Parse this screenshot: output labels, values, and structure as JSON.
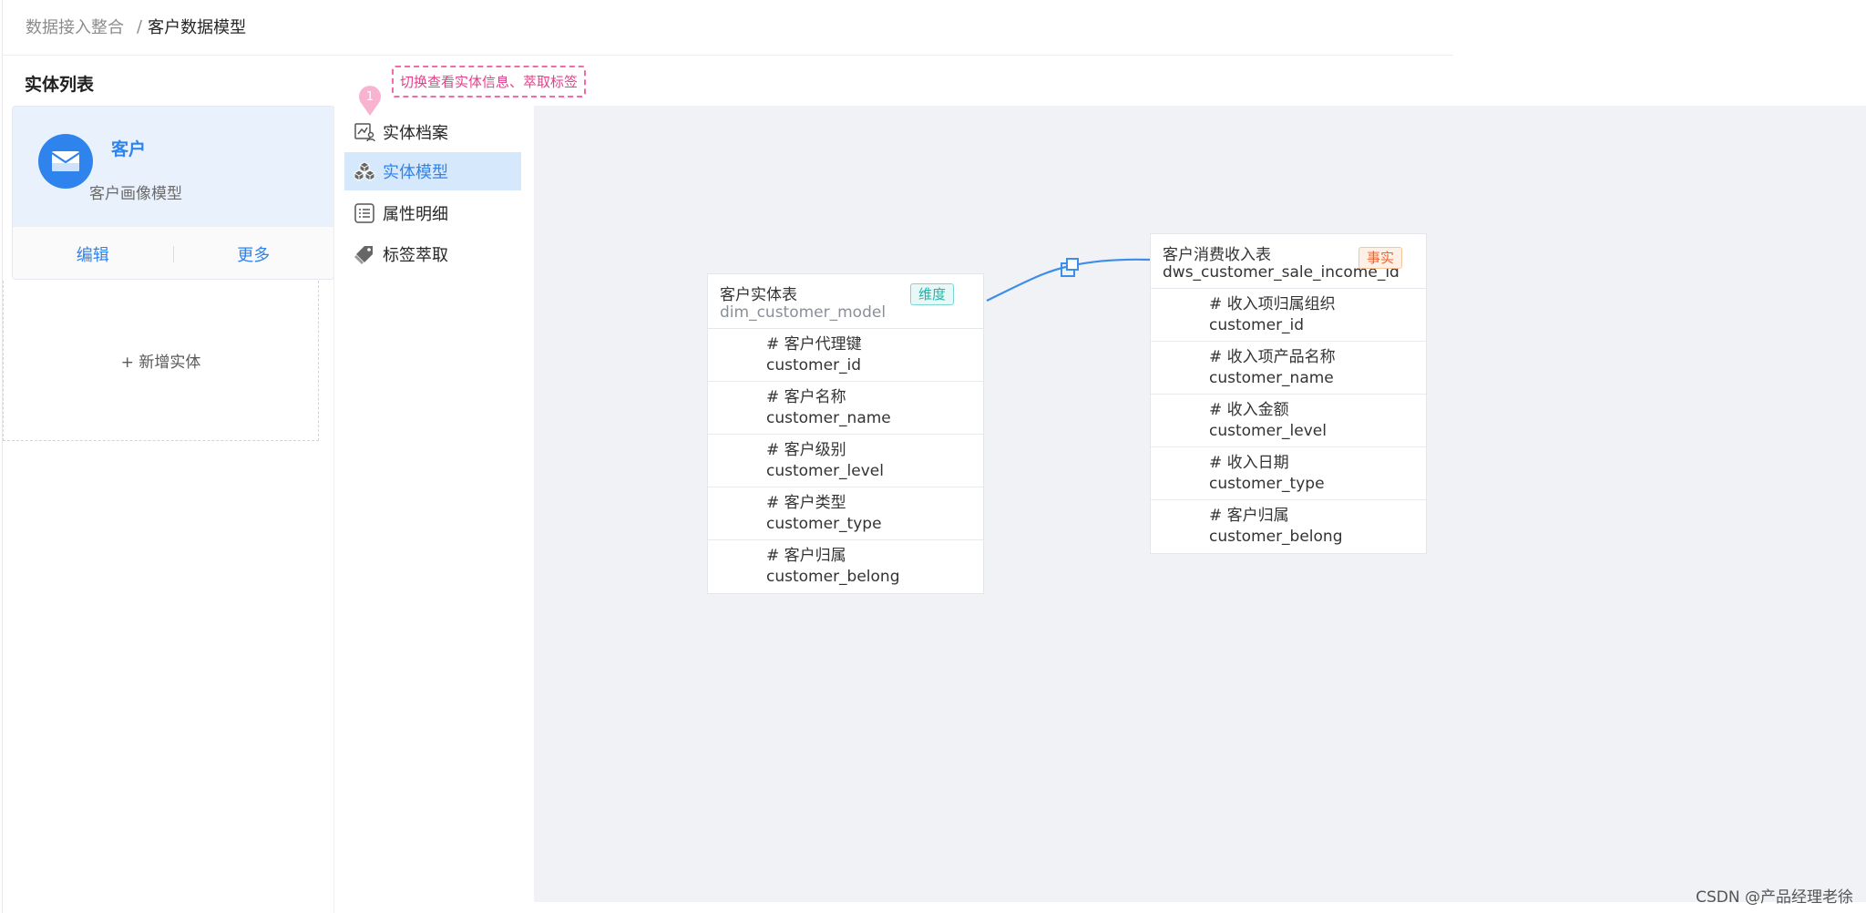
{
  "breadcrumb": {
    "parent": "数据接入整合",
    "separator": "/",
    "current": "客户数据模型"
  },
  "section_title": "实体列表",
  "entity_card": {
    "name": "客户",
    "description": "客户画像模型",
    "edit_label": "编辑",
    "more_label": "更多",
    "avatar_icon": "envelope-icon"
  },
  "add_entity_label": "+ 新增实体",
  "menu": [
    {
      "label": "实体档案",
      "icon": "profile-chart-icon",
      "active": false
    },
    {
      "label": "实体模型",
      "icon": "cubes-icon",
      "active": true
    },
    {
      "label": "属性明细",
      "icon": "list-icon",
      "active": false
    },
    {
      "label": "标签萃取",
      "icon": "tags-icon",
      "active": false
    }
  ],
  "annotation": {
    "number": "1",
    "text": "切换查看实体信息、萃取标签"
  },
  "dim_table": {
    "title": "客户实体表",
    "name": "dim_customer_model",
    "tag": "维度",
    "fields": [
      {
        "cn": "# 客户代理键",
        "en": "customer_id"
      },
      {
        "cn": "# 客户名称",
        "en": "customer_name"
      },
      {
        "cn": "# 客户级别",
        "en": "customer_level"
      },
      {
        "cn": "# 客户类型",
        "en": "customer_type"
      },
      {
        "cn": "# 客户归属",
        "en": "customer_belong"
      }
    ]
  },
  "fact_table": {
    "title": "客户消费收入表",
    "name": "dws_customer_sale_income_id",
    "tag": "事实",
    "fields": [
      {
        "cn": "# 收入项归属组织",
        "en": "customer_id"
      },
      {
        "cn": "# 收入项产品名称",
        "en": "customer_name"
      },
      {
        "cn": "# 收入金额",
        "en": "customer_level"
      },
      {
        "cn": "# 收入日期",
        "en": "customer_type"
      },
      {
        "cn": "# 客户归属",
        "en": "customer_belong"
      }
    ]
  },
  "colors": {
    "primary": "#2f83ec",
    "annotation": "#f56aa6",
    "canvas": "#f0f2f6",
    "dim_tag": "#1fb5aa",
    "fact_tag": "#f0642c"
  },
  "watermark": "CSDN @产品经理老徐"
}
